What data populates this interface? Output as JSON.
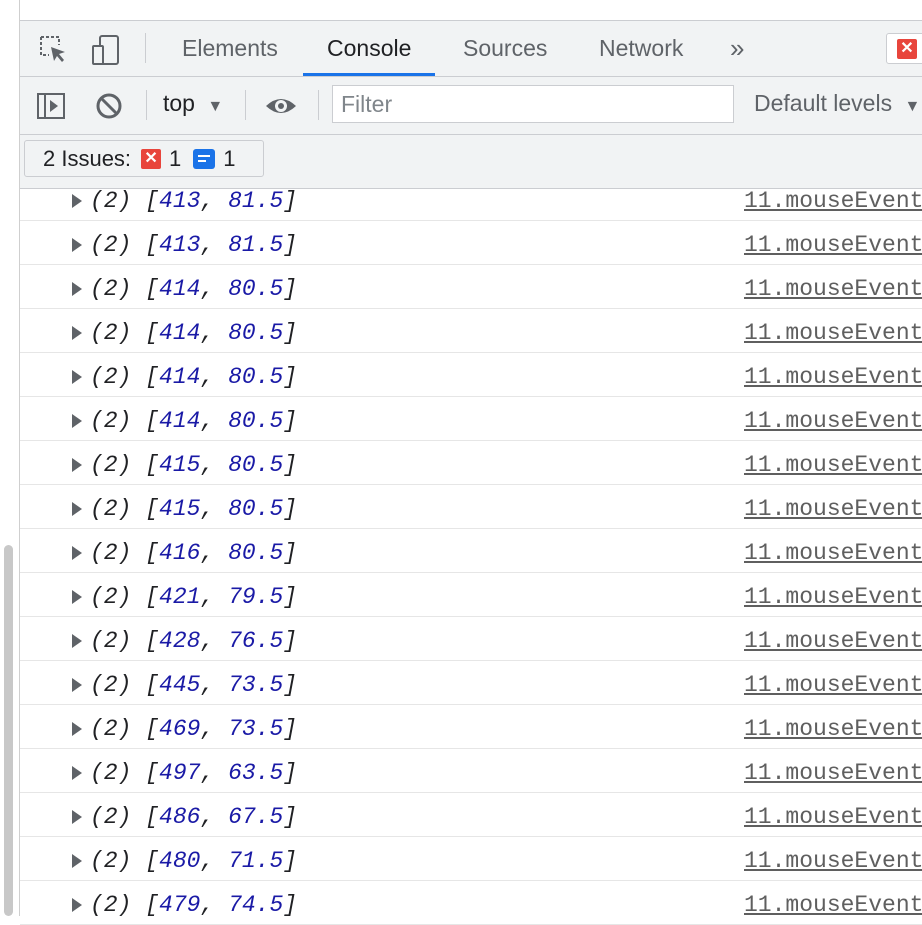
{
  "tabs": [
    "Elements",
    "Console",
    "Sources",
    "Network"
  ],
  "more_tabs_glyph": "»",
  "toolbar": {
    "context": "top",
    "filter_placeholder": "Filter",
    "levels": "Default levels"
  },
  "issues": {
    "label": "2 Issues:",
    "error_count": "1",
    "info_count": "1",
    "error_glyph": "✕"
  },
  "close_glyph": "✕",
  "log": {
    "source": "11.mouseEvent",
    "prefix": "(2)",
    "rows": [
      [
        "413",
        "81.5"
      ],
      [
        "413",
        "81.5"
      ],
      [
        "414",
        "80.5"
      ],
      [
        "414",
        "80.5"
      ],
      [
        "414",
        "80.5"
      ],
      [
        "414",
        "80.5"
      ],
      [
        "415",
        "80.5"
      ],
      [
        "415",
        "80.5"
      ],
      [
        "416",
        "80.5"
      ],
      [
        "421",
        "79.5"
      ],
      [
        "428",
        "76.5"
      ],
      [
        "445",
        "73.5"
      ],
      [
        "469",
        "73.5"
      ],
      [
        "497",
        "63.5"
      ],
      [
        "486",
        "67.5"
      ],
      [
        "480",
        "71.5"
      ],
      [
        "479",
        "74.5"
      ]
    ]
  },
  "icons": {
    "inspect": "inspect-element-icon",
    "device": "device-toolbar-icon",
    "sidebar": "console-sidebar-icon",
    "clear": "clear-console-icon",
    "eye": "live-expression-eye-icon"
  }
}
